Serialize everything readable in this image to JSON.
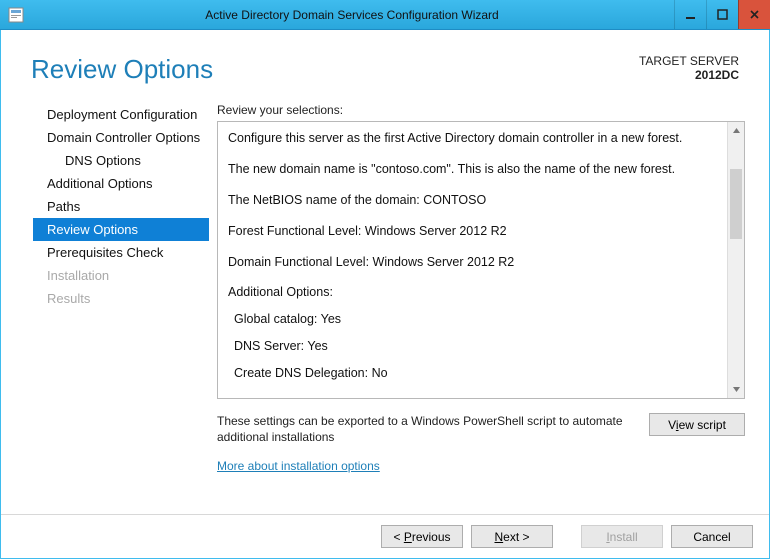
{
  "window": {
    "title": "Active Directory Domain Services Configuration Wizard"
  },
  "header": {
    "page_title": "Review Options",
    "target_label": "TARGET SERVER",
    "target_value": "2012DC"
  },
  "nav": {
    "items": [
      {
        "label": "Deployment Configuration",
        "state": "normal"
      },
      {
        "label": "Domain Controller Options",
        "state": "normal"
      },
      {
        "label": "DNS Options",
        "state": "indent"
      },
      {
        "label": "Additional Options",
        "state": "normal"
      },
      {
        "label": "Paths",
        "state": "normal"
      },
      {
        "label": "Review Options",
        "state": "selected"
      },
      {
        "label": "Prerequisites Check",
        "state": "normal"
      },
      {
        "label": "Installation",
        "state": "disabled"
      },
      {
        "label": "Results",
        "state": "disabled"
      }
    ]
  },
  "main": {
    "review_label": "Review your selections:",
    "review_lines": {
      "l0": "Configure this server as the first Active Directory domain controller in a new forest.",
      "l1": "The new domain name is \"contoso.com\". This is also the name of the new forest.",
      "l2": "The NetBIOS name of the domain: CONTOSO",
      "l3": "Forest Functional Level: Windows Server 2012 R2",
      "l4": "Domain Functional Level: Windows Server 2012 R2",
      "l5": "Additional Options:",
      "l6": "Global catalog: Yes",
      "l7": "DNS Server: Yes",
      "l8": "Create DNS Delegation: No"
    },
    "export_text": "These settings can be exported to a Windows PowerShell script to automate additional installations",
    "view_script_before": "V",
    "view_script_underline": "i",
    "view_script_after": "ew script",
    "more_link": "More about installation options"
  },
  "footer": {
    "previous_before": "< ",
    "previous_u": "P",
    "previous_after": "revious",
    "next_u": "N",
    "next_after": "ext >",
    "install_u": "I",
    "install_after": "nstall",
    "cancel": "Cancel"
  }
}
